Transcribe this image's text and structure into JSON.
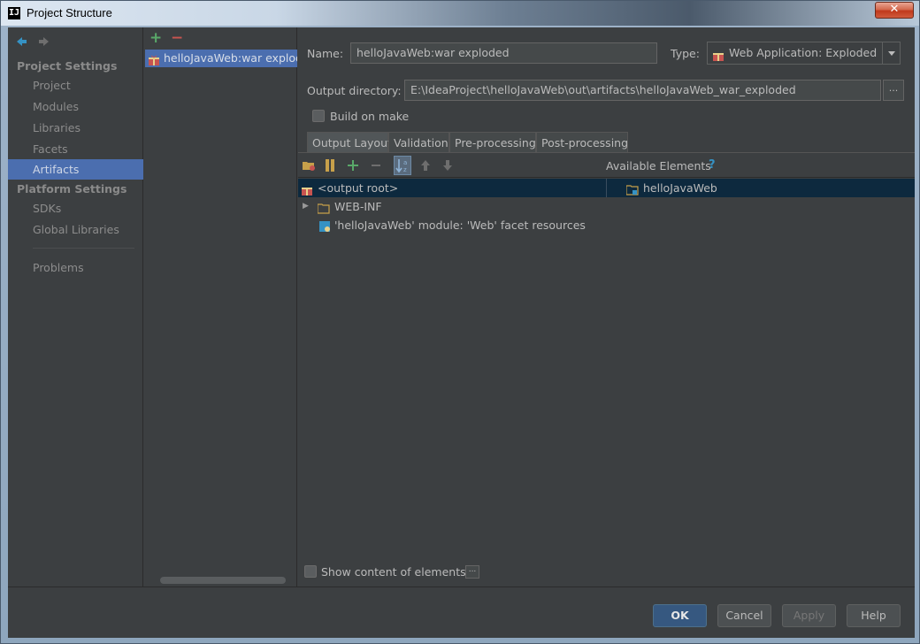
{
  "window": {
    "title": "Project Structure",
    "app_icon_text": "IJ",
    "close_label": "✕"
  },
  "nav": {
    "sections": [
      {
        "title": "Project Settings",
        "items": [
          "Project",
          "Modules",
          "Libraries",
          "Facets",
          "Artifacts"
        ]
      },
      {
        "title": "Platform Settings",
        "items": [
          "SDKs",
          "Global Libraries"
        ]
      }
    ],
    "selected": "Artifacts",
    "extra_item": "Problems"
  },
  "artifacts": {
    "list": [
      "helloJavaWeb:war exploded"
    ]
  },
  "form": {
    "name_label": "Name:",
    "name_value": "helloJavaWeb:war exploded",
    "type_label": "Type:",
    "type_value": "Web Application: Exploded",
    "output_label": "Output directory:",
    "output_value": "E:\\IdeaProject\\helloJavaWeb\\out\\artifacts\\helloJavaWeb_war_exploded",
    "browse_label": "...",
    "build_on_make_label": "Build on make",
    "build_on_make_checked": false
  },
  "tabs": [
    "Output Layout",
    "Validation",
    "Pre-processing",
    "Post-processing"
  ],
  "selected_tab": "Output Layout",
  "layout": {
    "available_label": "Available Elements",
    "help": "?",
    "tree": [
      {
        "label": "<output root>",
        "icon": "gift-icon",
        "selected": true
      },
      {
        "label": "WEB-INF",
        "icon": "folder-icon",
        "expandable": true
      },
      {
        "label": "'helloJavaWeb' module: 'Web' facet resources",
        "icon": "web-module-icon"
      }
    ],
    "available": [
      {
        "label": "helloJavaWeb",
        "icon": "module-folder-icon"
      }
    ],
    "show_content_label": "Show content of elements",
    "show_content_checked": false,
    "dots_label": "..."
  },
  "buttons": {
    "ok": "OK",
    "cancel": "Cancel",
    "apply": "Apply",
    "help": "Help"
  },
  "colors": {
    "selection": "#4b6eaf",
    "tree_selection": "#0d293e",
    "background": "#3c3f41"
  }
}
